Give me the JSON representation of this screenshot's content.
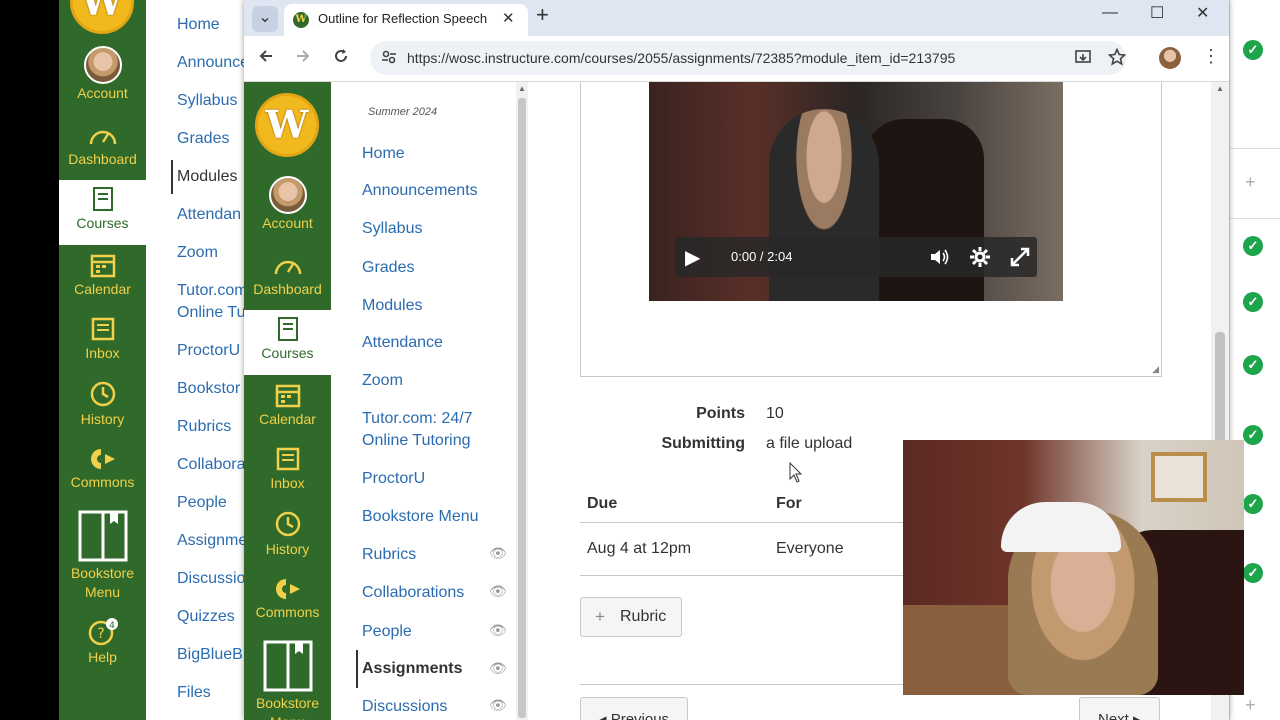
{
  "background_window": {
    "global_nav": [
      {
        "label": "Account",
        "icon": "avatar"
      },
      {
        "label": "Dashboard",
        "icon": "dashboard-icon"
      },
      {
        "label": "Courses",
        "icon": "courses-icon",
        "active": true
      },
      {
        "label": "Calendar",
        "icon": "calendar-icon"
      },
      {
        "label": "Inbox",
        "icon": "inbox-icon"
      },
      {
        "label": "History",
        "icon": "history-icon"
      },
      {
        "label": "Commons",
        "icon": "commons-icon"
      },
      {
        "label": "Bookstore Menu",
        "icon": "bookstore-icon"
      },
      {
        "label": "Help",
        "icon": "help-icon",
        "badge": "4"
      }
    ],
    "course_nav": [
      "Home",
      "Announce",
      "Syllabus",
      "Grades",
      "Modules",
      "Attendan",
      "Zoom",
      "Tutor.com",
      "Online Tu",
      "ProctorU",
      "Bookstor",
      "Rubrics",
      "Collabora",
      "People",
      "Assignme",
      "Discussio",
      "Quizzes",
      "BigBlueB",
      "Files"
    ]
  },
  "browser": {
    "tab_title": "Outline for Reflection Speech",
    "favicon_letter": "W",
    "url": "https://wosc.instructure.com/courses/2055/assignments/72385?module_item_id=213795",
    "controls": {
      "minimize": "—",
      "maximize": "☐",
      "close": "✕",
      "new_tab": "+",
      "tab_search": "⌄",
      "tab_close": "✕"
    }
  },
  "canvas": {
    "logo_letter": "W",
    "global_nav": [
      {
        "label": "Account"
      },
      {
        "label": "Dashboard"
      },
      {
        "label": "Courses",
        "active": true
      },
      {
        "label": "Calendar"
      },
      {
        "label": "Inbox"
      },
      {
        "label": "History"
      },
      {
        "label": "Commons"
      },
      {
        "label": "Bookstore Menu"
      }
    ],
    "term": "Summer 2024",
    "course_nav": [
      {
        "label": "Home"
      },
      {
        "label": "Announcements"
      },
      {
        "label": "Syllabus"
      },
      {
        "label": "Grades"
      },
      {
        "label": "Modules"
      },
      {
        "label": "Attendance"
      },
      {
        "label": "Zoom"
      },
      {
        "label": "Tutor.com: 24/7",
        "label2": "Online Tutoring"
      },
      {
        "label": "ProctorU"
      },
      {
        "label": "Bookstore Menu"
      },
      {
        "label": "Rubrics",
        "hidden": true
      },
      {
        "label": "Collaborations",
        "hidden": true
      },
      {
        "label": "People",
        "hidden": true
      },
      {
        "label": "Assignments",
        "hidden": true,
        "active": true
      },
      {
        "label": "Discussions",
        "hidden": true
      }
    ],
    "video": {
      "time": "0:00 / 2:04"
    },
    "details": {
      "points_label": "Points",
      "points_value": "10",
      "submitting_label": "Submitting",
      "submitting_value": "a file upload"
    },
    "due_table": {
      "headers": [
        "Due",
        "For"
      ],
      "rows": [
        [
          "Aug 4 at 12pm",
          "Everyone"
        ]
      ]
    },
    "rubric_button": "Rubric",
    "previous_button": "◂ Previous",
    "next_button": "Next ▸"
  },
  "colors": {
    "nav_green": "#2f6a2a",
    "nav_gold": "#f2d04a",
    "link_blue": "#2b6cb0",
    "check_green": "#1ea54c"
  }
}
